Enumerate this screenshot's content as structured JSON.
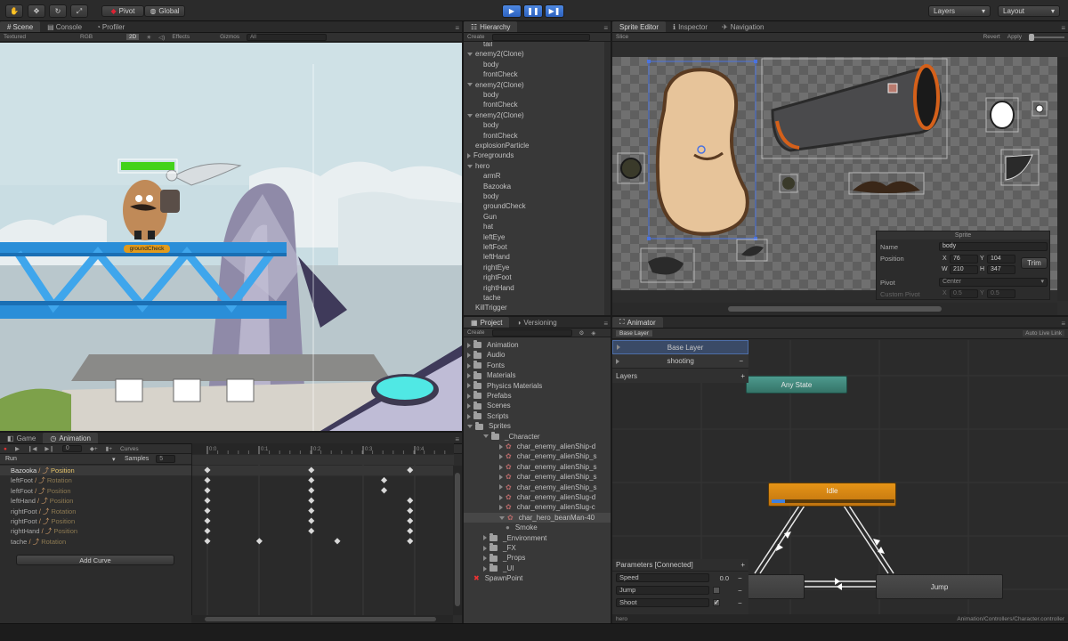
{
  "toolbar": {
    "pivot_label": "Pivot",
    "global_label": "Global",
    "layers_label": "Layers",
    "layout_label": "Layout"
  },
  "scene": {
    "tabs": [
      "Scene",
      "Console",
      "Profiler"
    ],
    "sub": {
      "textured": "Textured",
      "rgb": "RGB",
      "mode2d": "2D",
      "effects": "Effects",
      "gizmos": "Gizmos",
      "search_placeholder": "All"
    },
    "ground_check_label": "groundCheck"
  },
  "hierarchy": {
    "tab": "Hierarchy",
    "create_label": "Create",
    "items": [
      {
        "label": "tail",
        "indent": 2,
        "fold": "none"
      },
      {
        "label": "enemy2(Clone)",
        "indent": 0,
        "fold": "open"
      },
      {
        "label": "body",
        "indent": 2,
        "fold": "none"
      },
      {
        "label": "frontCheck",
        "indent": 2,
        "fold": "none"
      },
      {
        "label": "enemy2(Clone)",
        "indent": 0,
        "fold": "open"
      },
      {
        "label": "body",
        "indent": 2,
        "fold": "none"
      },
      {
        "label": "frontCheck",
        "indent": 2,
        "fold": "none"
      },
      {
        "label": "enemy2(Clone)",
        "indent": 0,
        "fold": "open"
      },
      {
        "label": "body",
        "indent": 2,
        "fold": "none"
      },
      {
        "label": "frontCheck",
        "indent": 2,
        "fold": "none"
      },
      {
        "label": "explosionParticle",
        "indent": 1,
        "fold": "none"
      },
      {
        "label": "Foregrounds",
        "indent": 0,
        "fold": "closed"
      },
      {
        "label": "hero",
        "indent": 0,
        "fold": "open"
      },
      {
        "label": "armR",
        "indent": 2,
        "fold": "none"
      },
      {
        "label": "Bazooka",
        "indent": 2,
        "fold": "none"
      },
      {
        "label": "body",
        "indent": 2,
        "fold": "none"
      },
      {
        "label": "groundCheck",
        "indent": 2,
        "fold": "none"
      },
      {
        "label": "Gun",
        "indent": 2,
        "fold": "none"
      },
      {
        "label": "hat",
        "indent": 2,
        "fold": "none"
      },
      {
        "label": "leftEye",
        "indent": 2,
        "fold": "none"
      },
      {
        "label": "leftFoot",
        "indent": 2,
        "fold": "none"
      },
      {
        "label": "leftHand",
        "indent": 2,
        "fold": "none"
      },
      {
        "label": "rightEye",
        "indent": 2,
        "fold": "none"
      },
      {
        "label": "rightFoot",
        "indent": 2,
        "fold": "none"
      },
      {
        "label": "rightHand",
        "indent": 2,
        "fold": "none"
      },
      {
        "label": "tache",
        "indent": 2,
        "fold": "none"
      },
      {
        "label": "KillTrigger",
        "indent": 1,
        "fold": "none"
      }
    ]
  },
  "sprite_editor": {
    "tabs": [
      "Sprite Editor",
      "Inspector",
      "Navigation"
    ],
    "slice_label": "Slice",
    "revert_label": "Revert",
    "apply_label": "Apply",
    "panel": {
      "title": "Sprite",
      "name_label": "Name",
      "name_value": "body",
      "position_label": "Position",
      "x_label": "X",
      "x_value": "76",
      "y_label": "Y",
      "y_value": "104",
      "w_label": "W",
      "w_value": "210",
      "h_label": "H",
      "h_value": "347",
      "trim_label": "Trim",
      "pivot_label": "Pivot",
      "pivot_value": "Center",
      "custom_pivot_label": "Custom Pivot",
      "cx_label": "X",
      "cx_value": "0.5",
      "cy_label": "Y",
      "cy_value": "0.5"
    }
  },
  "project": {
    "tabs": [
      "Project",
      "Versioning"
    ],
    "create_label": "Create",
    "items": [
      {
        "label": "Animation",
        "indent": 0,
        "type": "folder",
        "fold": "closed"
      },
      {
        "label": "Audio",
        "indent": 0,
        "type": "folder",
        "fold": "closed"
      },
      {
        "label": "Fonts",
        "indent": 0,
        "type": "folder",
        "fold": "closed"
      },
      {
        "label": "Materials",
        "indent": 0,
        "type": "folder",
        "fold": "closed"
      },
      {
        "label": "Physics Materials",
        "indent": 0,
        "type": "folder",
        "fold": "closed"
      },
      {
        "label": "Prefabs",
        "indent": 0,
        "type": "folder",
        "fold": "closed"
      },
      {
        "label": "Scenes",
        "indent": 0,
        "type": "folder",
        "fold": "closed"
      },
      {
        "label": "Scripts",
        "indent": 0,
        "type": "folder",
        "fold": "closed"
      },
      {
        "label": "Sprites",
        "indent": 0,
        "type": "folder",
        "fold": "open"
      },
      {
        "label": "_Character",
        "indent": 1,
        "type": "folder",
        "fold": "open"
      },
      {
        "label": "char_enemy_alienShip-d",
        "indent": 2,
        "type": "sprite",
        "fold": "closed"
      },
      {
        "label": "char_enemy_alienShip_s",
        "indent": 2,
        "type": "sprite",
        "fold": "closed"
      },
      {
        "label": "char_enemy_alienShip_s",
        "indent": 2,
        "type": "sprite",
        "fold": "closed"
      },
      {
        "label": "char_enemy_alienShip_s",
        "indent": 2,
        "type": "sprite",
        "fold": "closed"
      },
      {
        "label": "char_enemy_alienShip_s",
        "indent": 2,
        "type": "sprite",
        "fold": "closed"
      },
      {
        "label": "char_enemy_alienSlug-d",
        "indent": 2,
        "type": "sprite",
        "fold": "closed"
      },
      {
        "label": "char_enemy_alienSlug-c",
        "indent": 2,
        "type": "sprite",
        "fold": "closed"
      },
      {
        "label": "char_hero_beanMan-40",
        "indent": 2,
        "type": "sprite",
        "fold": "open",
        "selected": true
      },
      {
        "label": "Smoke",
        "indent": 2,
        "type": "smoke",
        "fold": "none"
      },
      {
        "label": "_Environment",
        "indent": 1,
        "type": "folder",
        "fold": "closed"
      },
      {
        "label": "_FX",
        "indent": 1,
        "type": "folder",
        "fold": "closed"
      },
      {
        "label": "_Props",
        "indent": 1,
        "type": "folder",
        "fold": "closed"
      },
      {
        "label": "_UI",
        "indent": 1,
        "type": "folder",
        "fold": "closed"
      },
      {
        "label": "SpawnPoint",
        "indent": 0,
        "type": "error",
        "fold": "none"
      }
    ]
  },
  "animation": {
    "tabs": [
      "Game",
      "Animation"
    ],
    "frame_value": "0",
    "curves_label": "Curves",
    "clip_name": "Run",
    "samples_label": "Samples",
    "samples_value": "5",
    "time_labels": [
      "0:0",
      "0:1",
      "0:2",
      "0:3",
      "0:4"
    ],
    "tracks": [
      {
        "object": "Bazooka",
        "property": "Position",
        "selected": true
      },
      {
        "object": "leftFoot",
        "property": "Rotation"
      },
      {
        "object": "leftFoot",
        "property": "Position"
      },
      {
        "object": "leftHand",
        "property": "Position"
      },
      {
        "object": "rightFoot",
        "property": "Rotation"
      },
      {
        "object": "rightFoot",
        "property": "Position"
      },
      {
        "object": "rightHand",
        "property": "Position"
      },
      {
        "object": "tache",
        "property": "Rotation"
      }
    ],
    "add_curve_label": "Add Curve"
  },
  "animator": {
    "tab": "Animator",
    "breadcrumb": "Base Layer",
    "auto_live_link": "Auto Live Link",
    "layers": [
      "Base Layer",
      "shooting"
    ],
    "layers_header": "Layers",
    "states": {
      "any_state": "Any State",
      "idle": "Idle",
      "jump": "Jump"
    },
    "parameters_header": "Parameters [Connected]",
    "parameters": [
      {
        "name": "Speed",
        "value": "0.0",
        "type": "float"
      },
      {
        "name": "Jump",
        "type": "bool",
        "checked": false
      },
      {
        "name": "Shoot",
        "type": "bool",
        "checked": true
      }
    ],
    "footer_left": "hero",
    "footer_right": "Animation/Controllers/Character.controller"
  },
  "colors": {
    "accent": "#3d80e0",
    "idle_state": "#d88a12",
    "any_state": "#3e8a80",
    "selection": "#3b5f9a"
  }
}
